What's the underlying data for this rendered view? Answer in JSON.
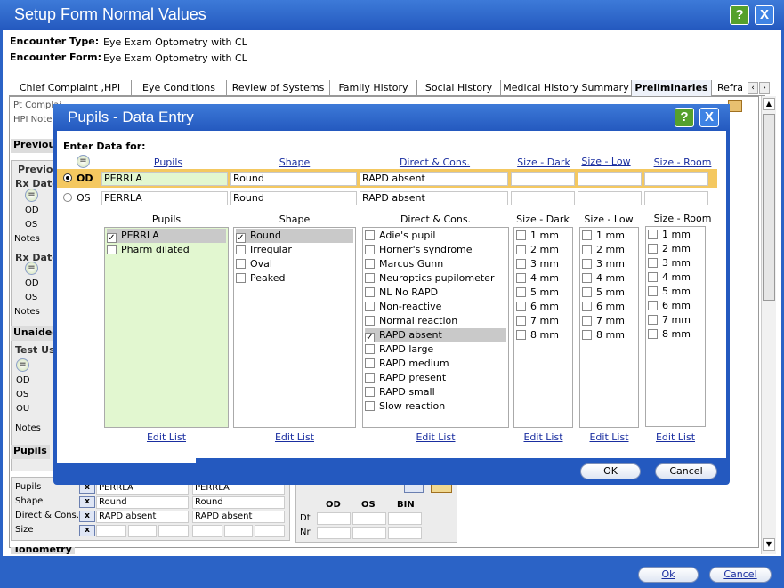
{
  "window": {
    "title": "Setup Form Normal Values",
    "help": "?",
    "close": "X"
  },
  "header": {
    "encounter_type_label": "Encounter Type:",
    "encounter_type_value": "Eye Exam Optometry with CL",
    "encounter_form_label": "Encounter Form:",
    "encounter_form_value": "Eye Exam Optometry with CL"
  },
  "tabs": [
    {
      "label": "Chief Complaint ,HPI"
    },
    {
      "label": "Eye Conditions"
    },
    {
      "label": "Review of Systems"
    },
    {
      "label": "Family History"
    },
    {
      "label": "Social History"
    },
    {
      "label": "Medical History Summary"
    },
    {
      "label": "Preliminaries"
    },
    {
      "label": "Refra"
    }
  ],
  "background": {
    "pt_complaint": "Pt Complai",
    "hpi_notes": "HPI Note",
    "previous1": "Previou",
    "previous2": "Previou",
    "rx_date1": "Rx Date",
    "rx_date2": "Rx Date",
    "od": "OD",
    "os": "OS",
    "ou": "OU",
    "notes": "Notes",
    "unaided": "Unaided",
    "test_used": "Test Us",
    "pupils_section": "Pupils",
    "tonometry": "Tonometry",
    "rows": [
      {
        "label": "Pupils",
        "od": "PERRLA",
        "os": "PERRLA"
      },
      {
        "label": "Shape",
        "od": "Round",
        "os": "Round"
      },
      {
        "label": "Direct & Cons.",
        "od": "RAPD absent",
        "os": "RAPD absent"
      },
      {
        "label": "Size",
        "od": "",
        "os": ""
      }
    ],
    "right_table": {
      "od": "OD",
      "os": "OS",
      "bin": "BIN",
      "dt": "Dt",
      "nr": "Nr"
    }
  },
  "dialog": {
    "title": "Pupils - Data Entry",
    "help": "?",
    "close": "X",
    "enter_data_for": "Enter Data for:",
    "header_links": [
      "Pupils",
      "Shape",
      "Direct & Cons.",
      "Size - Dark",
      "Size - Low Light",
      "Size - Room Light"
    ],
    "od_row": {
      "eye": "OD",
      "pupils": "PERRLA",
      "shape": "Round",
      "direct": "RAPD absent"
    },
    "os_row": {
      "eye": "OS",
      "pupils": "PERRLA",
      "shape": "Round",
      "direct": "RAPD absent"
    },
    "list_headers": [
      "Pupils",
      "Shape",
      "Direct & Cons.",
      "Size - Dark",
      "Size - Low Light",
      "Size - Room Light"
    ],
    "pupils_options": [
      {
        "label": "PERRLA",
        "checked": true
      },
      {
        "label": "Pharm dilated",
        "checked": false
      }
    ],
    "shape_options": [
      {
        "label": "Round",
        "checked": true
      },
      {
        "label": "Irregular",
        "checked": false
      },
      {
        "label": "Oval",
        "checked": false
      },
      {
        "label": "Peaked",
        "checked": false
      }
    ],
    "direct_options": [
      {
        "label": "Adie's pupil",
        "checked": false
      },
      {
        "label": "Horner's syndrome",
        "checked": false
      },
      {
        "label": "Marcus Gunn",
        "checked": false
      },
      {
        "label": "Neuroptics pupilometer",
        "checked": false
      },
      {
        "label": "NL No RAPD",
        "checked": false
      },
      {
        "label": "Non-reactive",
        "checked": false
      },
      {
        "label": "Normal reaction",
        "checked": false
      },
      {
        "label": "RAPD absent",
        "checked": true
      },
      {
        "label": "RAPD large",
        "checked": false
      },
      {
        "label": "RAPD medium",
        "checked": false
      },
      {
        "label": "RAPD present",
        "checked": false
      },
      {
        "label": "RAPD small",
        "checked": false
      },
      {
        "label": "Slow reaction",
        "checked": false
      }
    ],
    "sizes": [
      "1 mm",
      "2 mm",
      "3 mm",
      "4 mm",
      "5 mm",
      "6 mm",
      "7 mm",
      "8 mm"
    ],
    "edit_list": "Edit List",
    "ok": "OK",
    "cancel": "Cancel"
  },
  "footer": {
    "ok": "Ok",
    "cancel": "Cancel"
  }
}
